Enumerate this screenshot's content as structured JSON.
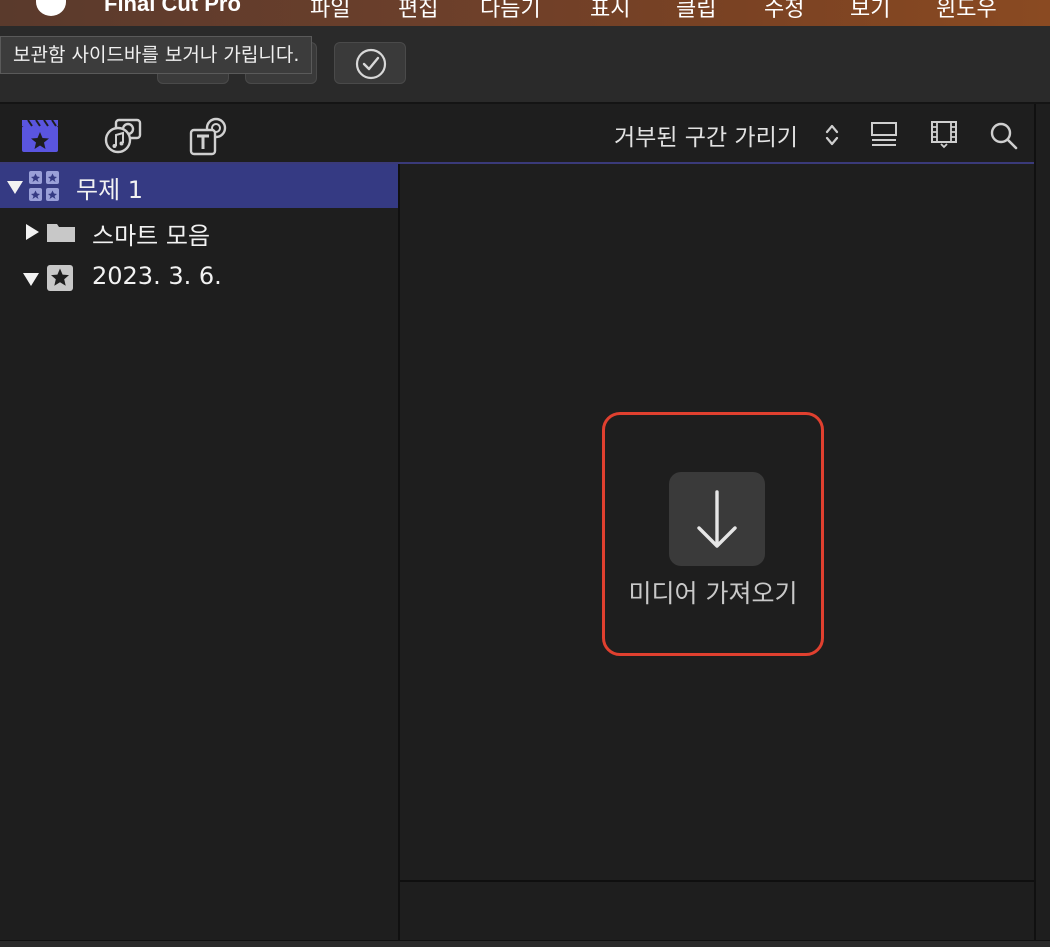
{
  "menubar": {
    "app_name": "Final Cut Pro",
    "items": [
      "파일",
      "편집",
      "다듬기",
      "표시",
      "클립",
      "수정",
      "보기",
      "윈도우"
    ]
  },
  "toolbar": {
    "tooltip": "보관함 사이드바를 보거나 가립니다."
  },
  "browser": {
    "filter_label": "거부된 구간 가리기"
  },
  "sidebar": {
    "library": "무제 1",
    "smart_collections": "스마트 모음",
    "event": "2023. 3. 6."
  },
  "content": {
    "import_label": "미디어 가져오기"
  },
  "colors": {
    "accent": "#5a55e0",
    "selection": "#353a83",
    "highlight": "#e0402f"
  }
}
